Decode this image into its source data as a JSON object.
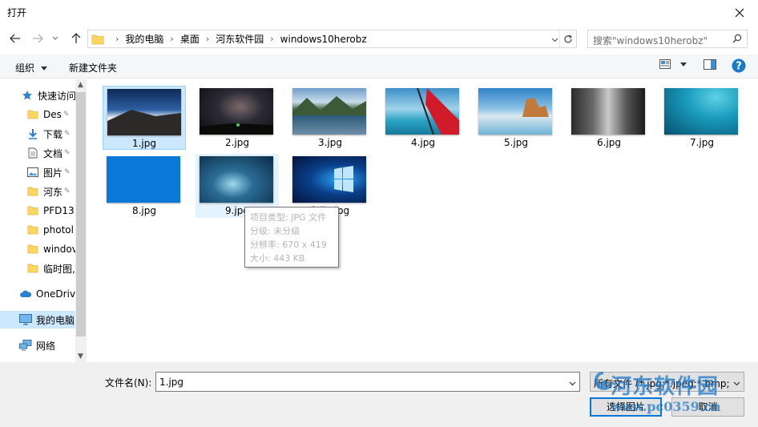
{
  "window": {
    "title": "打开"
  },
  "address": {
    "crumbs": [
      "我的电脑",
      "桌面",
      "河东软件园",
      "windows10herobz"
    ]
  },
  "search": {
    "placeholder": "搜索\"windows10herobz\""
  },
  "toolbar": {
    "organize": "组织",
    "new_folder": "新建文件夹"
  },
  "sidebar": {
    "items": [
      {
        "label": "快速访问",
        "icon": "star-icon",
        "pinned": false
      },
      {
        "label": "Des",
        "icon": "folder-icon",
        "pinned": true
      },
      {
        "label": "下载",
        "icon": "download-icon",
        "pinned": true
      },
      {
        "label": "文档",
        "icon": "document-icon",
        "pinned": true
      },
      {
        "label": "图片",
        "icon": "picture-icon",
        "pinned": true
      },
      {
        "label": "河东",
        "icon": "folder-icon",
        "pinned": true
      },
      {
        "label": "PFD13.",
        "icon": "folder-icon",
        "pinned": false
      },
      {
        "label": "photol",
        "icon": "folder-icon",
        "pinned": false
      },
      {
        "label": "windov",
        "icon": "folder-icon",
        "pinned": false
      },
      {
        "label": "临时图,",
        "icon": "folder-icon",
        "pinned": false
      },
      {
        "label": "OneDriv",
        "icon": "cloud-icon",
        "pinned": false
      },
      {
        "label": "我的电脑",
        "icon": "computer-icon",
        "pinned": false,
        "selected": true
      },
      {
        "label": "网络",
        "icon": "network-icon",
        "pinned": false
      }
    ]
  },
  "files": [
    {
      "name": "1.jpg",
      "selected": true
    },
    {
      "name": "2.jpg"
    },
    {
      "name": "3.jpg"
    },
    {
      "name": "4.jpg"
    },
    {
      "name": "5.jpg"
    },
    {
      "name": "6.jpg"
    },
    {
      "name": "7.jpg"
    },
    {
      "name": "8.jpg"
    },
    {
      "name": "9.jpg",
      "hover": true
    },
    {
      "name": "fujia.jpg"
    }
  ],
  "tooltip": {
    "type": "项目类型: JPG 文件",
    "rating": "分级: 未分级",
    "resolution": "分辨率: 670 x 419",
    "size": "大小: 443 KB"
  },
  "footer": {
    "filename_label": "文件名(N):",
    "filename_value": "1.jpg",
    "filetype_value": "所有文件 (*.jpg;*.jpeg;*.bmp;*",
    "open_label": "选择图片",
    "cancel_label": "取消"
  },
  "watermark": {
    "line1": "河东软件园",
    "line2": "www.pc0359.cn"
  },
  "colors": {
    "accent": "#0078d7",
    "selection": "#cce8ff",
    "folder": "#ffd75e"
  }
}
